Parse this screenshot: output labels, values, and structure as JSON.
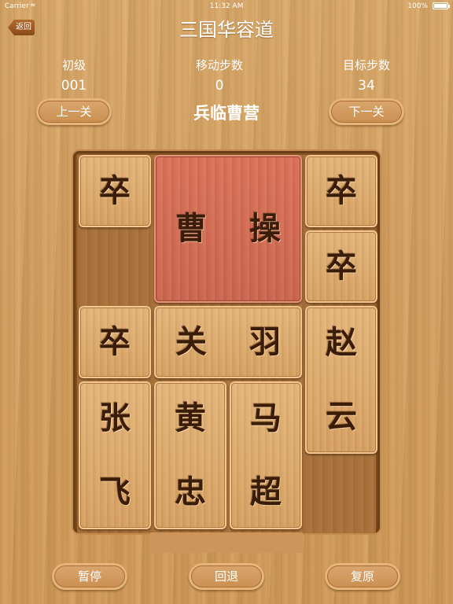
{
  "status": {
    "carrier": "Carrier",
    "time": "11:32 AM",
    "battery": "100%"
  },
  "nav": {
    "back": "返回",
    "title": "三国华容道"
  },
  "stats": [
    {
      "label": "初级",
      "value": "001"
    },
    {
      "label": "移动步数",
      "value": "0"
    },
    {
      "label": "目标步数",
      "value": "34"
    }
  ],
  "level": {
    "prev": "上一关",
    "name": "兵临曹营",
    "next": "下一关"
  },
  "pieces": {
    "soldier1": "卒",
    "caocao": [
      "曹",
      "操"
    ],
    "soldier2": "卒",
    "soldier3": "卒",
    "soldier4": "卒",
    "guanyu": [
      "关",
      "羽"
    ],
    "zhaoyun": [
      "赵",
      "云"
    ],
    "zhangfei": [
      "张",
      "飞"
    ],
    "huangzhong": [
      "黄",
      "忠"
    ],
    "machao": [
      "马",
      "超"
    ]
  },
  "controls": {
    "pause": "暂停",
    "undo": "回退",
    "reset": "复原"
  }
}
